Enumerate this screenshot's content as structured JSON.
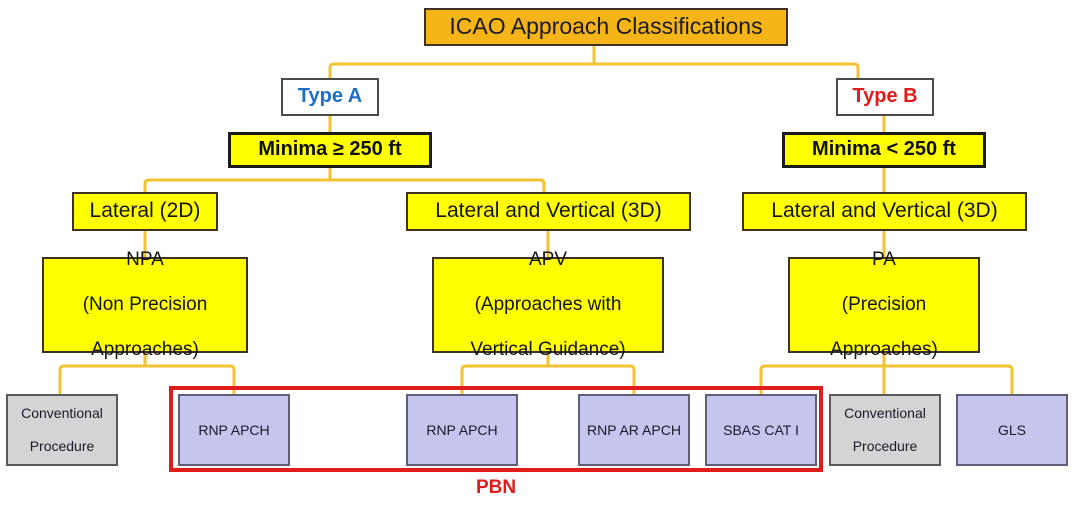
{
  "diagram": {
    "title": "ICAO Approach Classifications",
    "connector_color": "#f2c230",
    "group_outline_color": "#e01b1b",
    "nodes": {
      "title": {
        "label": "ICAO Approach Classifications"
      },
      "type_a": {
        "label": "Type A",
        "color": "#1f6fc4"
      },
      "type_b": {
        "label": "Type B",
        "color": "#e01b1b"
      },
      "minima_a": {
        "label": "Minima ≥ 250 ft"
      },
      "minima_b": {
        "label": "Minima < 250 ft"
      },
      "lateral_2d": {
        "label": "Lateral (2D)"
      },
      "lateral_vertical_3d_a": {
        "label": "Lateral and Vertical (3D)"
      },
      "lateral_vertical_3d_b": {
        "label": "Lateral and Vertical (3D)"
      },
      "npa": {
        "line1": "NPA",
        "line2": "(Non Precision",
        "line3": "Approaches)"
      },
      "apv": {
        "line1": "APV",
        "line2": "(Approaches with",
        "line3": "Vertical Guidance)"
      },
      "pa": {
        "line1": "PA",
        "line2": "(Precision",
        "line3": "Approaches)"
      },
      "conventional_left": {
        "line1": "Conventional",
        "line2": "Procedure"
      },
      "rnp_apch_1": {
        "label": "RNP APCH"
      },
      "rnp_apch_2": {
        "label": "RNP APCH"
      },
      "rnp_ar_apch": {
        "label": "RNP AR APCH"
      },
      "sbas_cat_i": {
        "label": "SBAS CAT I"
      },
      "conventional_right": {
        "line1": "Conventional",
        "line2": "Procedure"
      },
      "gls": {
        "label": "GLS"
      }
    },
    "group": {
      "pbn_label": "PBN"
    }
  }
}
